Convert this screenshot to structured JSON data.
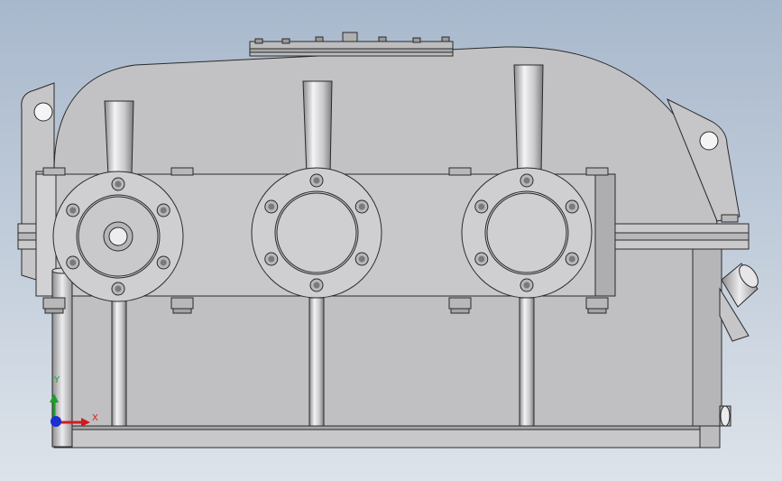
{
  "viewport": {
    "background_top": "#a8b8cc",
    "background_bottom": "#dde3ea"
  },
  "model": {
    "body_color": "#c4c4c6",
    "body_shade": "#b2b2b4",
    "edge_color": "#2a2a2a",
    "flange_color": "#cfcfd1",
    "shaft_count": 3,
    "bolt_color": "#b8b8ba"
  },
  "triad": {
    "x_label": "X",
    "y_label": "Y",
    "x_color": "#d11c1c",
    "y_color": "#1e9e2a",
    "z_color": "#1c2fd1"
  }
}
